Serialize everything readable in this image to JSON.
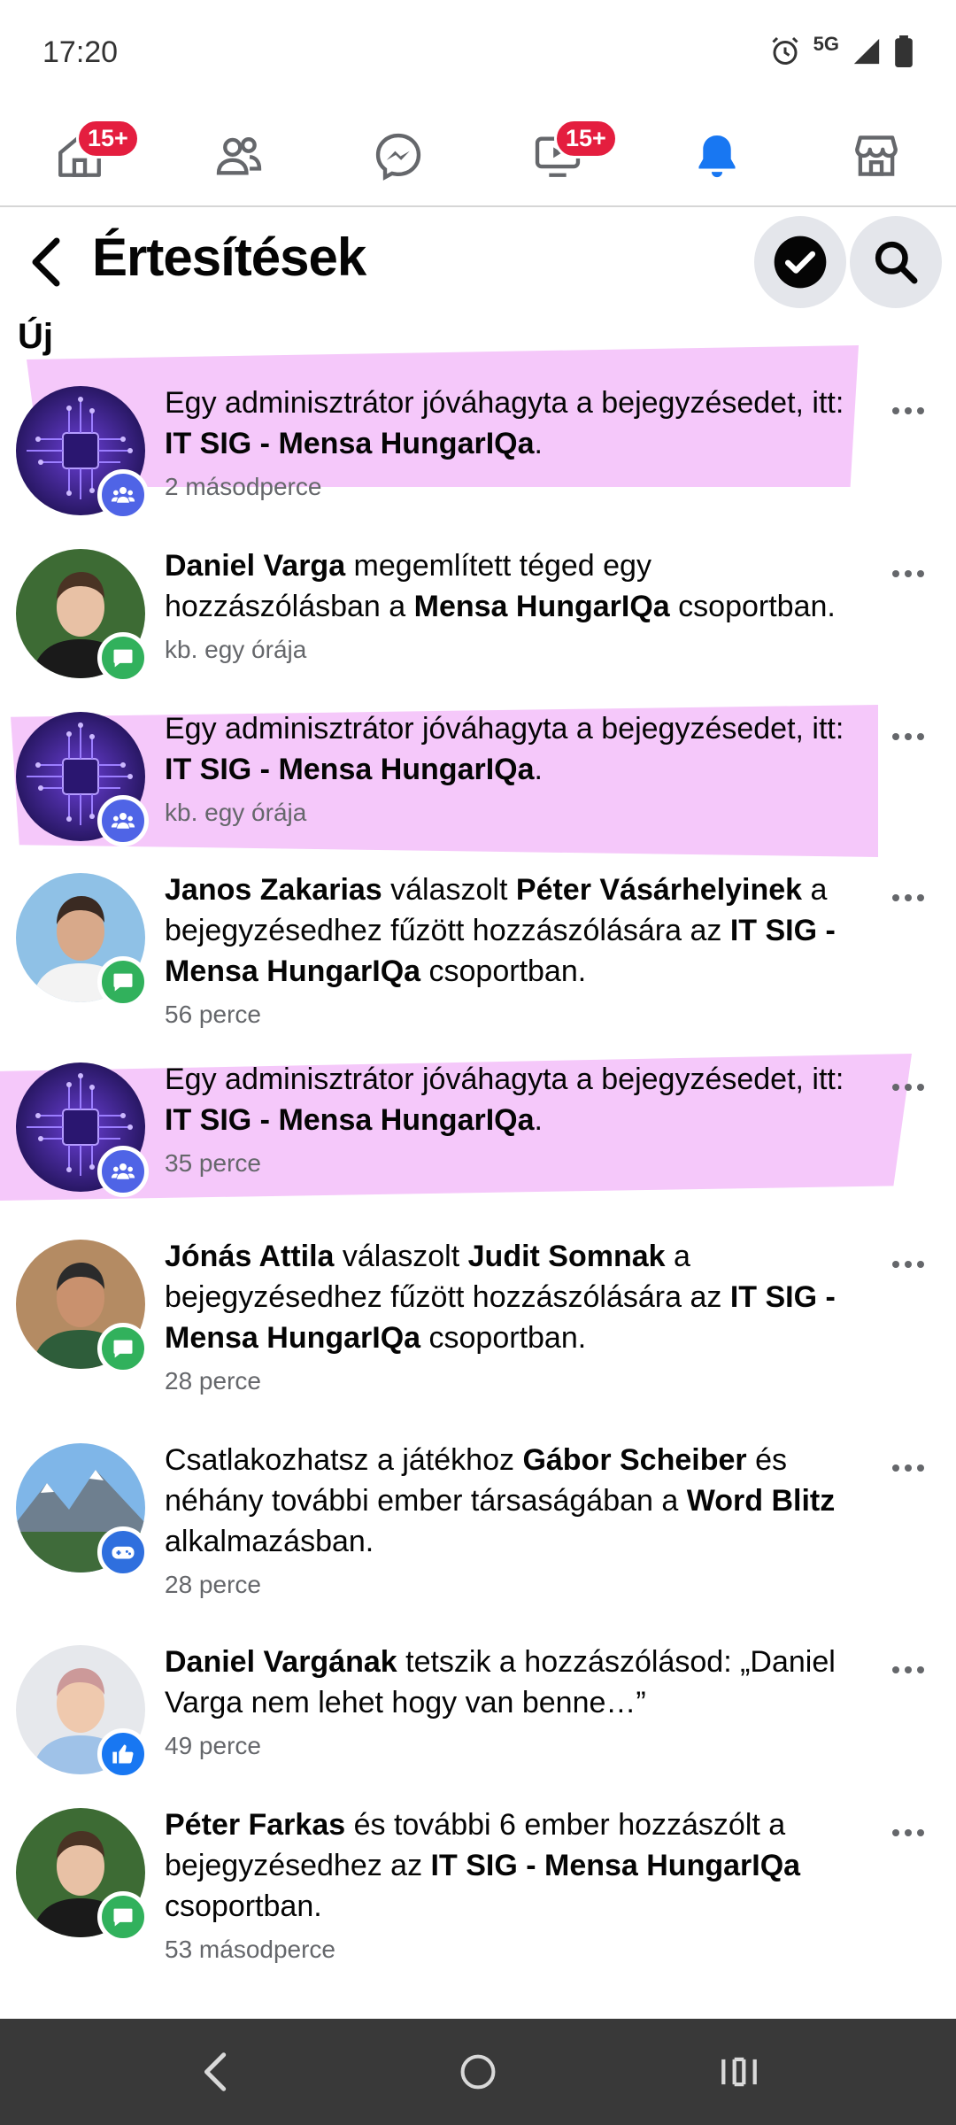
{
  "status_bar": {
    "time": "17:20",
    "network": "5G"
  },
  "nav": {
    "home_badge": "15+",
    "video_badge": "15+"
  },
  "header": {
    "title": "Értesítések"
  },
  "section": {
    "new_label": "Új"
  },
  "notifications": [
    {
      "type": "group",
      "highlighted": true,
      "parts": [
        [
          "Egy adminisztrátor jóváhagyta a bejegyzésedet, itt: ",
          false
        ],
        [
          "IT SIG - Mensa HungarIQa",
          true
        ],
        [
          ".",
          false
        ]
      ],
      "time": "2 másodperce"
    },
    {
      "type": "comment",
      "highlighted": false,
      "parts": [
        [
          "Daniel Varga",
          true
        ],
        [
          " megemlített téged egy hozzászólásban a ",
          false
        ],
        [
          "Mensa HungarIQa",
          true
        ],
        [
          " csoportban.",
          false
        ]
      ],
      "time": "kb. egy órája"
    },
    {
      "type": "group",
      "highlighted": true,
      "parts": [
        [
          "Egy adminisztrátor jóváhagyta a bejegyzésedet, itt: ",
          false
        ],
        [
          "IT SIG - Mensa HungarIQa",
          true
        ],
        [
          ".",
          false
        ]
      ],
      "time": "kb. egy órája"
    },
    {
      "type": "comment",
      "highlighted": false,
      "parts": [
        [
          "Janos Zakarias",
          true
        ],
        [
          " válaszolt ",
          false
        ],
        [
          "Péter Vásárhelyinek",
          true
        ],
        [
          " a bejegyzésedhez fűzött hozzászólására az ",
          false
        ],
        [
          "IT SIG - Mensa HungarIQa",
          true
        ],
        [
          " csoportban.",
          false
        ]
      ],
      "time": "56 perce"
    },
    {
      "type": "group",
      "highlighted": true,
      "parts": [
        [
          "Egy adminisztrátor jóváhagyta a bejegyzésedet, itt: ",
          false
        ],
        [
          "IT SIG - Mensa HungarIQa",
          true
        ],
        [
          ".",
          false
        ]
      ],
      "time": "35 perce"
    },
    {
      "type": "comment",
      "highlighted": false,
      "parts": [
        [
          "Jónás Attila",
          true
        ],
        [
          " válaszolt ",
          false
        ],
        [
          "Judit Somnak",
          true
        ],
        [
          " a bejegyzésedhez fűzött hozzászólására az ",
          false
        ],
        [
          "IT SIG - Mensa HungarIQa",
          true
        ],
        [
          " csoportban.",
          false
        ]
      ],
      "time": "28 perce"
    },
    {
      "type": "game",
      "highlighted": false,
      "parts": [
        [
          "Csatlakozhatsz a játékhoz ",
          false
        ],
        [
          "Gábor Scheiber",
          true
        ],
        [
          " és néhány további ember társaságában a ",
          false
        ],
        [
          "Word Blitz",
          true
        ],
        [
          " alkalmazásban.",
          false
        ]
      ],
      "time": "28 perce"
    },
    {
      "type": "like",
      "highlighted": false,
      "parts": [
        [
          "Daniel Vargának",
          true
        ],
        [
          " tetszik a hozzászólásod: „Daniel Varga nem lehet hogy van benne…”",
          false
        ]
      ],
      "time": "49 perce"
    },
    {
      "type": "comment",
      "highlighted": false,
      "parts": [
        [
          "Péter Farkas",
          true
        ],
        [
          " és további 6 ember hozzászólt a bejegyzésedhez az ",
          false
        ],
        [
          "IT SIG - Mensa HungarIQa",
          true
        ],
        [
          " csoportban.",
          false
        ]
      ],
      "time": "53 másodperce"
    }
  ],
  "colors": {
    "accent": "#1877f2",
    "badge": "#e41e3f",
    "highlight": "#f5c8fa",
    "group_badge": "#4f64e6",
    "comment_badge": "#31b15c",
    "like_badge": "#1877f2",
    "game_badge": "#2f6fde",
    "system_nav": "#393939"
  }
}
